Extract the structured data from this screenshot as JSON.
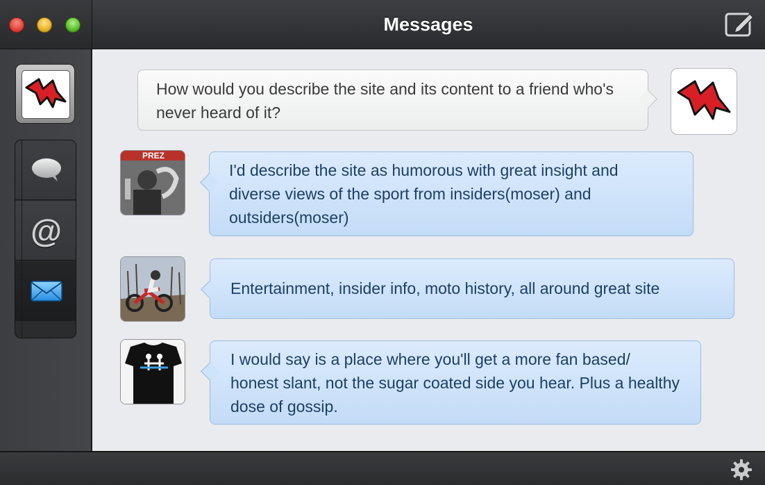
{
  "window": {
    "title": "Messages"
  },
  "messages": [
    {
      "text": "How would you describe the site and its content to a friend who's never heard of it?",
      "style": "outgoing"
    },
    {
      "text": "I'd describe the site as humorous with great insight and diverse views of the sport from insiders(moser) and outsiders(moser)",
      "style": "incoming",
      "avatar_label": "PREZ"
    },
    {
      "text": "Entertainment, insider info, moto history, all around great site",
      "style": "incoming"
    },
    {
      "text": "I would say is a place where you'll get a more fan based/ honest slant, not the sugar coated side you hear. Plus a healthy dose of gossip.",
      "style": "incoming"
    }
  ],
  "icons": {
    "compose": "compose-icon",
    "settings": "gear-icon",
    "chat": "speech-bubble-icon",
    "mentions": "at-sign-icon",
    "mail": "envelope-icon"
  },
  "sidebar": {
    "mentions_symbol": "@"
  },
  "colors": {
    "bubble_blue": "#c3dcf7",
    "bubble_gray": "#eceded",
    "accent_red": "#d91f26"
  }
}
